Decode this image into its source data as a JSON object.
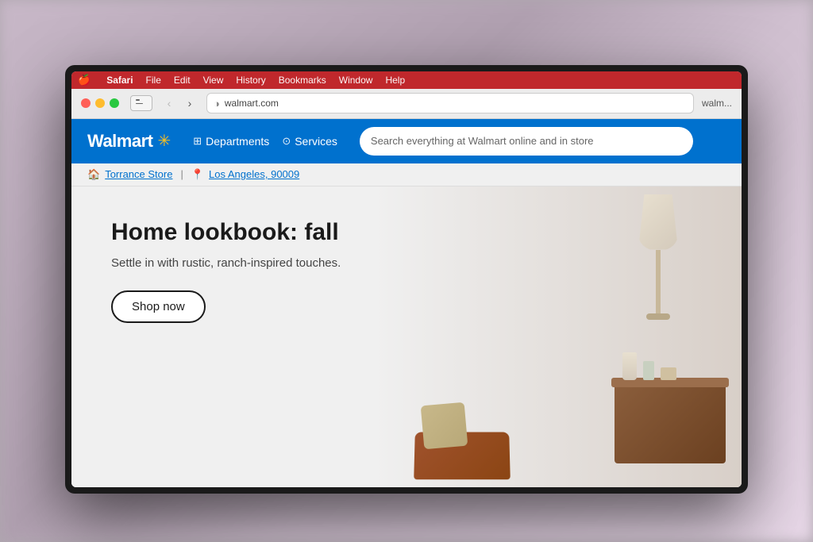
{
  "background": {
    "color": "#b0a8b0"
  },
  "macos": {
    "menubar": {
      "apple": "🍎",
      "items": [
        "Safari",
        "File",
        "Edit",
        "View",
        "History",
        "Bookmarks",
        "Window",
        "Help"
      ]
    },
    "toolbar": {
      "back_btn": "‹",
      "forward_btn": "›",
      "reader_icon": "◑",
      "address_text": "walmart.com",
      "account_text": "walm..."
    }
  },
  "walmart": {
    "logo_text": "Walmart",
    "spark_symbol": "✳",
    "nav": {
      "departments_label": "Departments",
      "services_label": "Services"
    },
    "search_placeholder": "Search everything at Walmart online and in store",
    "location_bar": {
      "store_icon": "🏠",
      "store_name": "Torrance Store",
      "separator": "|",
      "pin_icon": "📍",
      "location": "Los Angeles, 90009"
    },
    "hero": {
      "title": "Home lookbook: fall",
      "subtitle": "Settle in with rustic, ranch-inspired touches.",
      "shop_now": "Shop now"
    }
  }
}
